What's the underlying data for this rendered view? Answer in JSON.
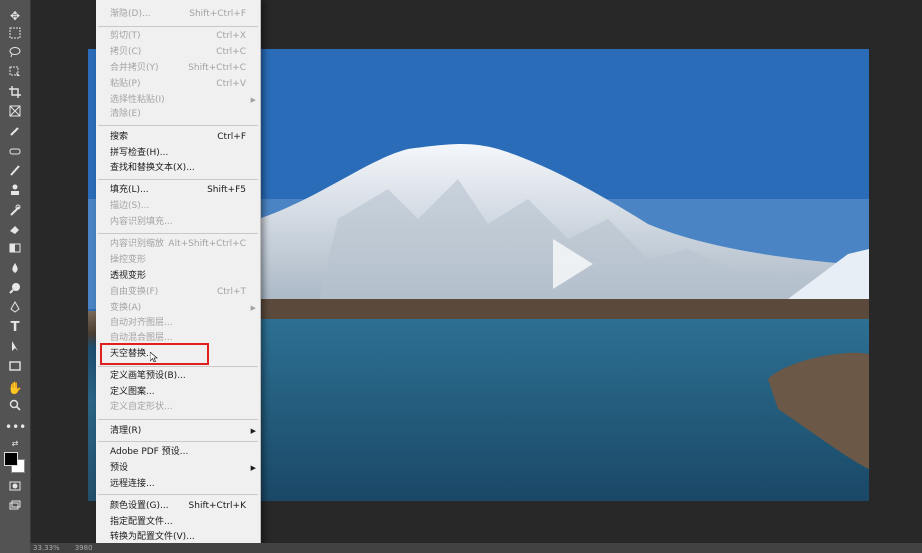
{
  "toolbar": {
    "tools": [
      "move-tool-icon",
      "marquee-tool-icon",
      "lasso-tool-icon",
      "object-select-tool-icon",
      "crop-tool-icon",
      "frame-tool-icon",
      "eyedropper-tool-icon",
      "spot-healing-tool-icon",
      "brush-tool-icon",
      "clone-stamp-tool-icon",
      "history-brush-tool-icon",
      "eraser-tool-icon",
      "gradient-tool-icon",
      "blur-tool-icon",
      "dodge-tool-icon",
      "pen-tool-icon",
      "type-tool-icon",
      "path-select-tool-icon",
      "rectangle-tool-icon",
      "hand-tool-icon",
      "zoom-tool-icon",
      "more-tools-icon"
    ]
  },
  "colors": {
    "foreground": "#000000",
    "background": "#ffffff",
    "highlight": "#e0201e"
  },
  "statusbar": {
    "zoom": "33.33%",
    "info": "3980"
  },
  "menu": {
    "items": [
      {
        "label": "渐隐(D)...",
        "shortcut": "Shift+Ctrl+F",
        "disabled": true
      },
      {
        "label": "剪切(T)",
        "shortcut": "Ctrl+X",
        "disabled": true
      },
      {
        "label": "拷贝(C)",
        "shortcut": "Ctrl+C",
        "disabled": true
      },
      {
        "label": "合并拷贝(Y)",
        "shortcut": "Shift+Ctrl+C",
        "disabled": true
      },
      {
        "label": "粘贴(P)",
        "shortcut": "Ctrl+V",
        "disabled": true
      },
      {
        "label": "选择性粘贴(I)",
        "shortcut": "",
        "disabled": true
      },
      {
        "label": "清除(E)",
        "shortcut": "",
        "disabled": true
      },
      {
        "label": "搜索",
        "shortcut": "Ctrl+F",
        "disabled": false
      },
      {
        "label": "拼写检查(H)...",
        "shortcut": "",
        "disabled": false
      },
      {
        "label": "查找和替换文本(X)...",
        "shortcut": "",
        "disabled": false
      },
      {
        "label": "填充(L)...",
        "shortcut": "Shift+F5",
        "disabled": false
      },
      {
        "label": "描边(S)...",
        "shortcut": "",
        "disabled": true
      },
      {
        "label": "内容识别填充...",
        "shortcut": "",
        "disabled": true
      },
      {
        "label": "内容识别缩放",
        "shortcut": "Alt+Shift+Ctrl+C",
        "disabled": true
      },
      {
        "label": "操控变形",
        "shortcut": "",
        "disabled": true
      },
      {
        "label": "透视变形",
        "shortcut": "",
        "disabled": false
      },
      {
        "label": "自由变换(F)",
        "shortcut": "Ctrl+T",
        "disabled": true
      },
      {
        "label": "变换(A)",
        "shortcut": "",
        "disabled": true
      },
      {
        "label": "自动对齐图层...",
        "shortcut": "",
        "disabled": true
      },
      {
        "label": "自动混合图层...",
        "shortcut": "",
        "disabled": true
      },
      {
        "label": "天空替换...",
        "shortcut": "",
        "disabled": false
      },
      {
        "label": "定义画笔预设(B)...",
        "shortcut": "",
        "disabled": false
      },
      {
        "label": "定义图案...",
        "shortcut": "",
        "disabled": false
      },
      {
        "label": "定义自定形状...",
        "shortcut": "",
        "disabled": true
      },
      {
        "label": "清理(R)",
        "shortcut": "",
        "disabled": false
      },
      {
        "label": "Adobe PDF 预设...",
        "shortcut": "",
        "disabled": false
      },
      {
        "label": "预设",
        "shortcut": "",
        "disabled": false
      },
      {
        "label": "远程连接...",
        "shortcut": "",
        "disabled": false
      },
      {
        "label": "颜色设置(G)...",
        "shortcut": "Shift+Ctrl+K",
        "disabled": false
      },
      {
        "label": "指定配置文件...",
        "shortcut": "",
        "disabled": false
      },
      {
        "label": "转换为配置文件(V)...",
        "shortcut": "",
        "disabled": false
      }
    ]
  }
}
